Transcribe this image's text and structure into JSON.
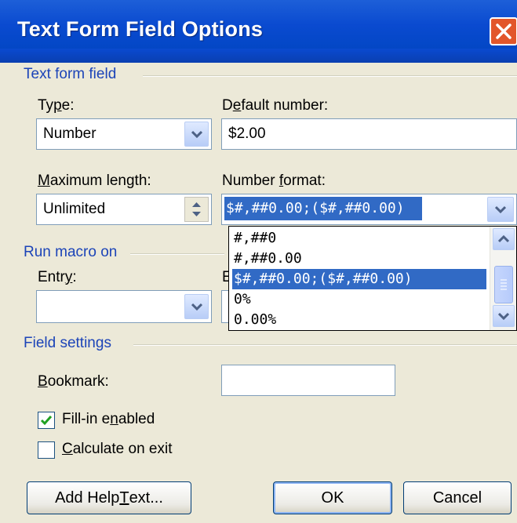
{
  "window": {
    "title": "Text Form Field Options"
  },
  "sections": {
    "text_form_field": "Text form field",
    "run_macro_on": "Run macro on",
    "field_settings": "Field settings"
  },
  "type": {
    "label_pre": "Ty",
    "label_key": "p",
    "label_post": "e:",
    "value": "Number"
  },
  "default_number": {
    "label_pre": "D",
    "label_key": "e",
    "label_post": "fault number:",
    "value": "$2.00"
  },
  "maximum_length": {
    "label_pre": "",
    "label_key": "M",
    "label_post": "aximum length:",
    "value": "Unlimited"
  },
  "number_format": {
    "label_pre": "Number ",
    "label_key": "f",
    "label_post": "ormat:",
    "value": "$#,##0.00;($#,##0.00)",
    "options": [
      "#,##0",
      "#,##0.00",
      "$#,##0.00;($#,##0.00)",
      "0%",
      "0.00%"
    ],
    "selected_index": 2
  },
  "entry": {
    "label_pre": "Entr",
    "label_key": "y",
    "label_post": ":",
    "value": ""
  },
  "exit": {
    "label_partial": "E"
  },
  "bookmark": {
    "label_pre": "",
    "label_key": "B",
    "label_post": "ookmark:",
    "value": ""
  },
  "fill_in_enabled": {
    "label_pre": "Fill-in e",
    "label_key": "n",
    "label_post": "abled",
    "checked": true
  },
  "calculate_on_exit": {
    "label_pre": "",
    "label_key": "C",
    "label_post": "alculate on exit",
    "checked": false
  },
  "buttons": {
    "add_help_text": {
      "pre": "Add Help ",
      "key": "T",
      "post": "ext..."
    },
    "ok": "OK",
    "cancel": "Cancel"
  },
  "colors": {
    "title_bar": "#0a4ad0",
    "dialog_bg": "#ece9d8",
    "section_text": "#1c44b8",
    "selection": "#316ac5",
    "close_button": "#e2562b"
  }
}
